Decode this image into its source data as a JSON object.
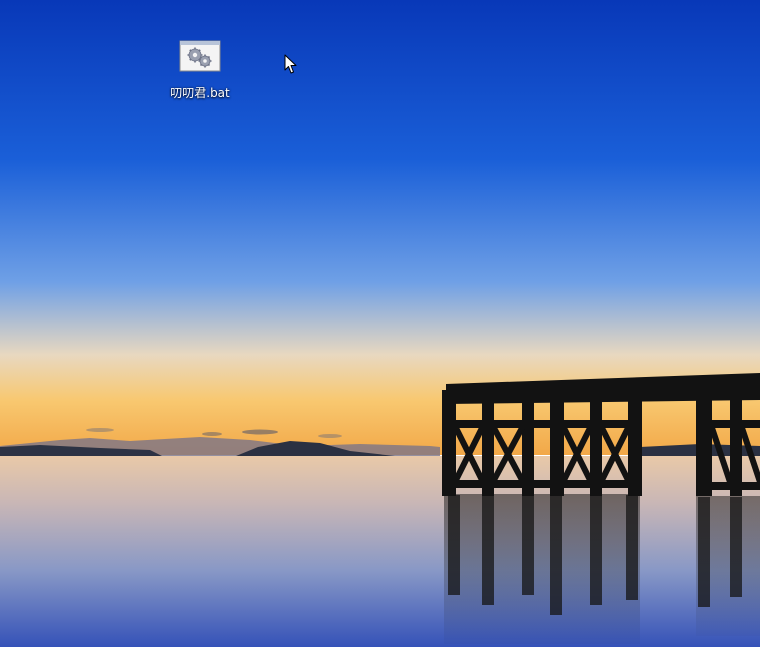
{
  "desktop": {
    "icons": [
      {
        "label": "叨叨君.bat",
        "icon": "batch-file-gear-icon"
      }
    ],
    "pointer": "arrow-cursor-icon"
  },
  "colors": {
    "sky_top": "#0a3fc0",
    "sky_mid": "#2a73e0",
    "horizon_glow": "#f7c46a",
    "water": "#8fa3c8",
    "pier_silhouette": "#111111"
  }
}
